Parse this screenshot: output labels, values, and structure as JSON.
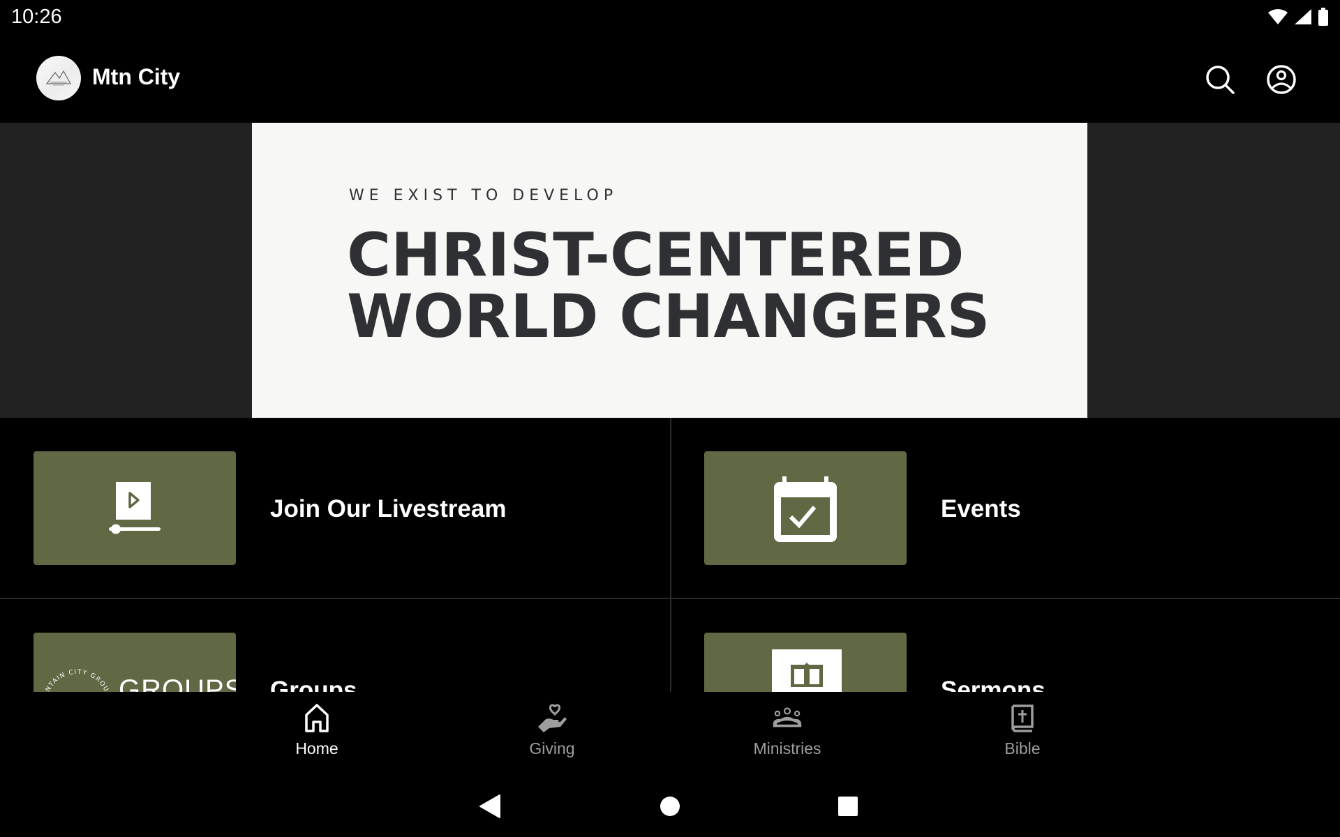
{
  "status_bar": {
    "time": "10:26",
    "icons": [
      "wifi-icon",
      "cellular-signal-icon",
      "battery-icon"
    ]
  },
  "app_bar": {
    "title": "Mtn City",
    "logo": "mountain-city-logo",
    "actions": [
      {
        "name": "search",
        "icon": "search-icon"
      },
      {
        "name": "account",
        "icon": "account-circle-icon"
      }
    ]
  },
  "hero": {
    "kicker": "WE EXIST TO DEVELOP",
    "headline_line1": "CHRIST-CENTERED",
    "headline_line2": "WORLD CHANGERS"
  },
  "tiles": [
    {
      "label": "Join Our Livestream",
      "icon": "livestream-video-icon"
    },
    {
      "label": "Events",
      "icon": "calendar-check-icon"
    },
    {
      "label": "Groups",
      "icon": "groups-badge-image",
      "image_text": "GROUPS",
      "image_arc_text": "MOUNTAIN CITY GROUPS"
    },
    {
      "label": "Sermons",
      "icon": "book-icon"
    }
  ],
  "bottom_nav": {
    "items": [
      {
        "label": "Home",
        "icon": "home-icon",
        "active": true
      },
      {
        "label": "Giving",
        "icon": "giving-hand-heart-icon",
        "active": false
      },
      {
        "label": "Ministries",
        "icon": "people-group-icon",
        "active": false
      },
      {
        "label": "Bible",
        "icon": "bible-icon",
        "active": false
      }
    ]
  },
  "system_nav": {
    "buttons": [
      "back",
      "home",
      "recents"
    ]
  },
  "colors": {
    "background": "#000000",
    "hero_side": "#222222",
    "hero_card": "#f7f7f5",
    "hero_text": "#2f3033",
    "tile_accent": "#606844",
    "nav_active": "#ffffff",
    "nav_inactive": "#9e9e9e"
  }
}
